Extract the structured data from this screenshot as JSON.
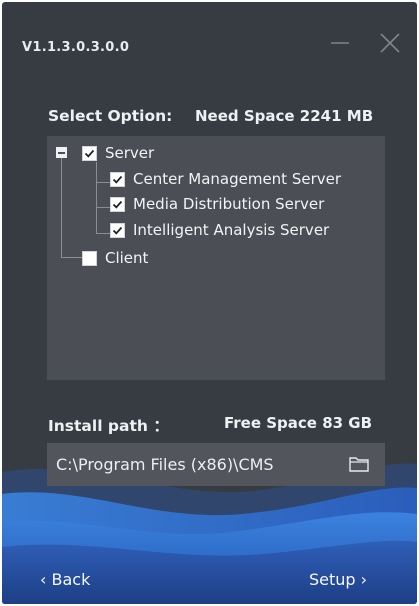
{
  "window": {
    "version": "V1.1.3.0.3.0.0"
  },
  "select": {
    "label": "Select Option:",
    "need_space": "Need Space 2241 MB"
  },
  "tree": {
    "server": {
      "label": "Server",
      "checked": true,
      "expanded": true
    },
    "children": [
      {
        "label": "Center Management Server",
        "checked": true
      },
      {
        "label": "Media Distribution Server",
        "checked": true
      },
      {
        "label": "Intelligent Analysis Server",
        "checked": true
      }
    ],
    "client": {
      "label": "Client",
      "checked": false
    }
  },
  "install": {
    "label": "Install path ：",
    "free_space": "Free Space 83 GB",
    "path": "C:\\Program Files (x86)\\CMS"
  },
  "footer": {
    "back": "‹ Back",
    "setup": "Setup ›"
  },
  "colors": {
    "background": "#373c43",
    "panel": "#4b4f55",
    "path_field": "#52565c",
    "accent_wave": "#2d6fd6"
  },
  "icons": [
    "minimize-icon",
    "close-icon",
    "collapse-icon",
    "checkbox-icon",
    "folder-icon"
  ]
}
